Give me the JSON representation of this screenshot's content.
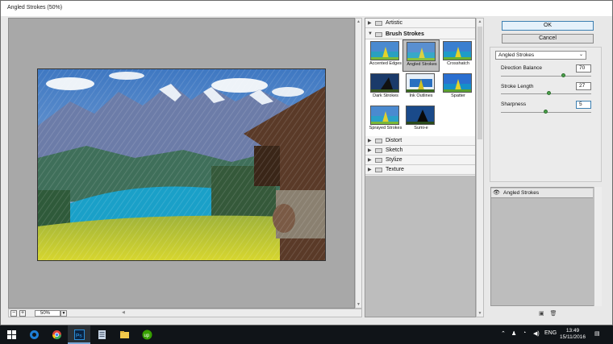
{
  "window": {
    "title": "Angled Strokes (50%)"
  },
  "preview": {
    "zoom": "50%"
  },
  "gallery": {
    "categories_top": [
      {
        "label": "Artistic",
        "state": "collapsed"
      },
      {
        "label": "Brush Strokes",
        "state": "expanded"
      }
    ],
    "thumbnails": [
      {
        "label": "Accented Edges",
        "selected": false
      },
      {
        "label": "Angled Strokes",
        "selected": true
      },
      {
        "label": "Crosshatch",
        "selected": false
      },
      {
        "label": "Dark Strokes",
        "selected": false
      },
      {
        "label": "Ink Outlines",
        "selected": false
      },
      {
        "label": "Spatter",
        "selected": false
      },
      {
        "label": "Sprayed Strokes",
        "selected": false
      },
      {
        "label": "Sumi-e",
        "selected": false
      }
    ],
    "categories_bottom": [
      {
        "label": "Distort"
      },
      {
        "label": "Sketch"
      },
      {
        "label": "Stylize"
      },
      {
        "label": "Texture"
      }
    ]
  },
  "buttons": {
    "ok": "OK",
    "cancel": "Cancel"
  },
  "settings": {
    "filter": "Angled Strokes",
    "params": [
      {
        "label": "Direction Balance",
        "value": "70",
        "level": 70,
        "max": 100
      },
      {
        "label": "Stroke Length",
        "value": "27",
        "level": 27,
        "max": 50
      },
      {
        "label": "Sharpness",
        "value": "5",
        "level": 5,
        "max": 10
      }
    ]
  },
  "layers": {
    "items": [
      {
        "label": "Angled Strokes"
      }
    ]
  },
  "taskbar": {
    "lang": "ENG",
    "time": "13:49",
    "date": "15/11/2016"
  },
  "colors": {
    "accent": "#3c7fb1",
    "slider_knob": "#4aa04a",
    "taskbar": "#101418"
  }
}
